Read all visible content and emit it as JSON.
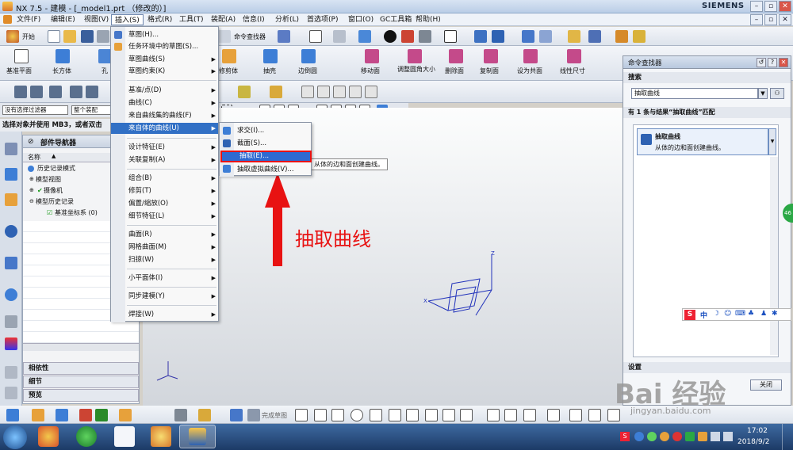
{
  "window": {
    "title": "NX 7.5 - 建模 - [_model1.prt （修改的）]",
    "brand": "SIEMENS",
    "controls": [
      "–",
      "▫",
      "✕"
    ],
    "doc_controls": [
      "–",
      "▫",
      "✕"
    ]
  },
  "menubar": [
    "文件(F)",
    "编辑(E)",
    "视图(V)",
    "插入(S)",
    "格式(R)",
    "工具(T)",
    "装配(A)",
    "信息(I)",
    "分析(L)",
    "首选项(P)",
    "窗口(O)",
    "GC工具箱",
    "帮助(H)"
  ],
  "toolbar1": {
    "start": "开始",
    "cmd_finder": "命令查找器"
  },
  "toolbar2": {
    "left": [
      "基准平面",
      "长方体",
      "孔"
    ],
    "right": [
      "修剪体",
      "抽壳",
      "边倒圆",
      "移动面",
      "调整圆角大小",
      "删除面",
      "复制面",
      "设为共面",
      "线性尺寸"
    ]
  },
  "selection": {
    "filter": "没有选择过滤器",
    "scope": "整个装配",
    "hint": "选择对象并使用 MB3，或者双击"
  },
  "nav": {
    "title": "部件导航器",
    "col": "名称",
    "items": [
      "历史记录模式",
      "模型视图",
      "摄像机",
      "模型历史记录",
      "基准坐标系 (0)"
    ],
    "bottom": [
      "相依性",
      "细节",
      "预览"
    ]
  },
  "insert_menu": [
    {
      "label": "草图(H)...",
      "arrow": false
    },
    {
      "label": "任务环境中的草图(S)...",
      "arrow": false
    },
    {
      "label": "草图曲线(S)",
      "arrow": true
    },
    {
      "label": "草图约束(K)",
      "arrow": true
    },
    {
      "label": "基准/点(D)",
      "arrow": true
    },
    {
      "label": "曲线(C)",
      "arrow": true
    },
    {
      "label": "来自曲线集的曲线(F)",
      "arrow": true
    },
    {
      "label": "来自体的曲线(U)",
      "arrow": true
    },
    {
      "label": "设计特征(E)",
      "arrow": true
    },
    {
      "label": "关联复制(A)",
      "arrow": true
    },
    {
      "label": "组合(B)",
      "arrow": true
    },
    {
      "label": "修剪(T)",
      "arrow": true
    },
    {
      "label": "偏置/缩放(O)",
      "arrow": true
    },
    {
      "label": "细节特征(L)",
      "arrow": true
    },
    {
      "label": "曲面(R)",
      "arrow": true
    },
    {
      "label": "网格曲面(M)",
      "arrow": true
    },
    {
      "label": "扫掠(W)",
      "arrow": true
    },
    {
      "label": "小平面体(I)",
      "arrow": true
    },
    {
      "label": "同步建模(Y)",
      "arrow": true
    },
    {
      "label": "焊接(W)",
      "arrow": true
    }
  ],
  "sub_menu": [
    "求交(I)...",
    "截面(S)...",
    "抽取(E)...",
    "抽取虚拟曲线(V)..."
  ],
  "tooltip": "从体的边和面创建曲线。",
  "annotation": "抽取曲线",
  "axes": {
    "z": "Z",
    "x": "X"
  },
  "command_finder": {
    "title": "命令查找器",
    "search_label": "搜索",
    "search_value": "抽取曲线",
    "result_header": "有 1 条与结果“抽取曲线”匹配",
    "result_title": "抽取曲线",
    "result_desc": "从体的边和面创建曲线。",
    "settings": "设置",
    "close": "关闭"
  },
  "ime": "中",
  "side_badge": "46",
  "cmd_bar": {
    "finish_sketch": "完成草图"
  },
  "taskbar": {
    "time": "17:02",
    "date": "2018/9/2"
  },
  "watermark": {
    "brand": "Bai 经验",
    "url": "jingyan.baidu.com"
  }
}
